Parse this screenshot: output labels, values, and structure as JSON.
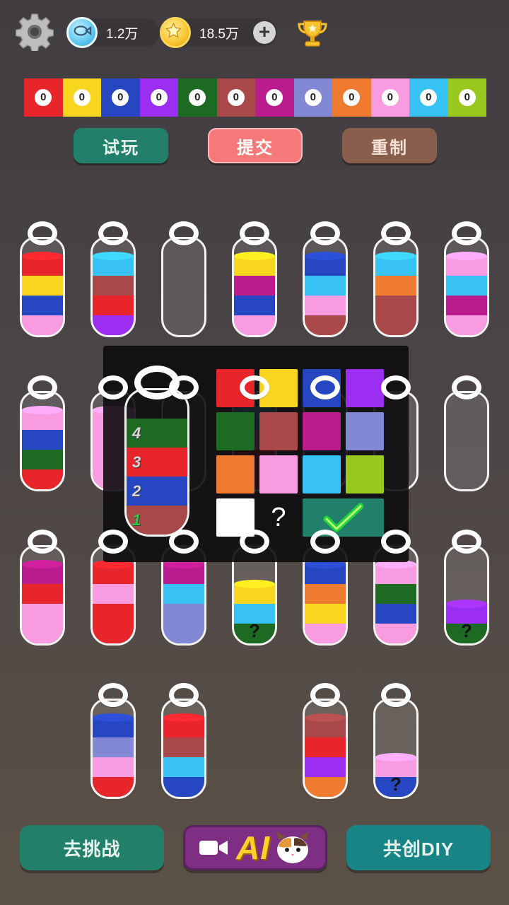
{
  "topbar": {
    "settings_icon": "gear-icon",
    "fish_amount": "1.2万",
    "coin_amount": "18.5万",
    "plus_label": "+",
    "trophy_icon": "trophy-icon"
  },
  "palette": [
    {
      "color": "#e8252a",
      "count": "0"
    },
    {
      "color": "#f8d61f",
      "count": "0"
    },
    {
      "color": "#2747c2",
      "count": "0"
    },
    {
      "color": "#9b2ef0",
      "count": "0"
    },
    {
      "color": "#1d6b23",
      "count": "0"
    },
    {
      "color": "#a84848",
      "count": "0"
    },
    {
      "color": "#bb1c8d",
      "count": "0"
    },
    {
      "color": "#8288d4",
      "count": "0"
    },
    {
      "color": "#ef7b30",
      "count": "0"
    },
    {
      "color": "#f99be0",
      "count": "0"
    },
    {
      "color": "#38c1f3",
      "count": "0"
    },
    {
      "color": "#99c91e",
      "count": "0"
    }
  ],
  "actions": {
    "try_label": "试玩",
    "submit_label": "提交",
    "reset_label": "重制"
  },
  "bottles_layers_bottom_to_top": [
    [
      "#f99be0",
      "#2747c2",
      "#f8d61f",
      "#e8252a"
    ],
    [
      "#9b2ef0",
      "#e8252a",
      "#a84848",
      "#38c1f3"
    ],
    [],
    [
      "#f99be0",
      "#2747c2",
      "#bb1c8d",
      "#f8d61f"
    ],
    [
      "#a84848",
      "#f99be0",
      "#38c1f3",
      "#2747c2"
    ],
    [
      "#a84848",
      "#a84848",
      "#ef7b30",
      "#38c1f3"
    ],
    [
      "#f99be0",
      "#bb1c8d",
      "#38c1f3",
      "#f99be0"
    ],
    [
      "#e8252a",
      "#1d6b23",
      "#2747c2",
      "#f99be0"
    ],
    [
      "#f99be0",
      "#f99be0",
      "#f99be0",
      "#f99be0"
    ],
    [],
    [
      "#e8252a",
      "#e8252a",
      "#f99be0",
      "#38c1f3"
    ],
    [
      "#2747c2",
      "#2747c2",
      "#1d6b23",
      "#1d6b23"
    ],
    [],
    [],
    [
      "#f99be0",
      "#f99be0",
      "#e8252a",
      "#bb1c8d"
    ],
    [
      "#e8252a",
      "#e8252a",
      "#f99be0",
      "#e8252a"
    ],
    [
      "#8288d4",
      "#8288d4",
      "#38c1f3",
      "#bb1c8d"
    ],
    [
      "#1d6b23",
      "#38c1f3",
      "#f8d61f"
    ],
    [
      "#f99be0",
      "#f8d61f",
      "#ef7b30",
      "#2747c2"
    ],
    [
      "#f99be0",
      "#2747c2",
      "#1d6b23",
      "#f99be0"
    ],
    [
      "#1d6b23",
      "#9b2ef0"
    ],
    [
      "#e8252a",
      "#f99be0",
      "#8288d4",
      "#2747c2"
    ],
    [
      "#2747c2",
      "#38c1f3",
      "#a84848",
      "#e8252a"
    ],
    [
      "#ef7b30",
      "#9b2ef0",
      "#e8252a",
      "#a84848"
    ],
    [
      "#2747c2",
      "#f99be0"
    ]
  ],
  "hidden_marker": "?",
  "editor": {
    "layers_bottom_to_top": [
      {
        "color": "#a84848",
        "num": "1"
      },
      {
        "color": "#2747c2",
        "num": "2"
      },
      {
        "color": "#e8252a",
        "num": "3"
      },
      {
        "color": "#1d6b23",
        "num": "4"
      }
    ],
    "picker_colors": [
      "#e8252a",
      "#f8d61f",
      "#2747c2",
      "#9b2ef0",
      "#1d6b23",
      "#a84848",
      "#bb1c8d",
      "#8288d4",
      "#ef7b30",
      "#f99be0",
      "#38c1f3",
      "#99c91e",
      "#ffffff"
    ],
    "unknown_label": "?",
    "confirm_icon": "checkmark-icon"
  },
  "bottom": {
    "challenge_label": "去挑战",
    "ai_label": "AI",
    "ai_icons": [
      "video-camera-icon",
      "cat-face-icon"
    ],
    "diy_label": "共创DIY"
  }
}
